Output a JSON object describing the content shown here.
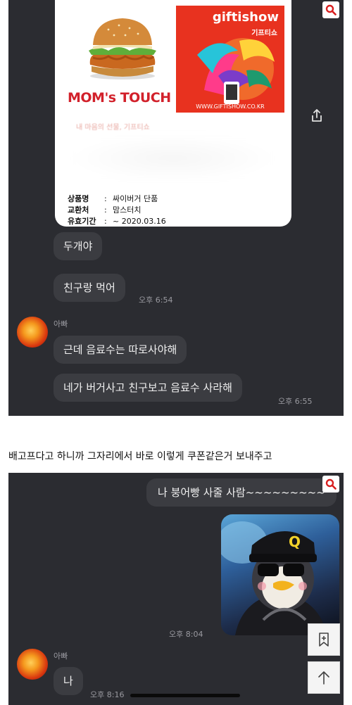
{
  "chat1": {
    "coupon": {
      "brand_logo": "MOM's TOUCH",
      "giftshow_title": "giftishow",
      "giftshow_sub": "기프티쇼",
      "giftshow_url": "WWW.GIFTISHOW.CO.KR",
      "blurred_message": "내 마음의 선물, 기프티쇼",
      "fields": [
        {
          "label": "상품명",
          "value": "싸이버거 단품"
        },
        {
          "label": "교환처",
          "value": "맘스터치"
        },
        {
          "label": "유효기간",
          "value": "~ 2020.03.16"
        }
      ]
    },
    "messages_sent": [
      {
        "text": "두개야"
      },
      {
        "text": "친구랑 먹어",
        "time": "오후 6:54"
      }
    ],
    "sender_name": "아빠",
    "messages_received": [
      {
        "text": "근데 음료수는 따로사야해"
      },
      {
        "text": "네가 버거사고 친구보고 음료수 사라해",
        "time": "오후 6:55"
      }
    ]
  },
  "caption": "배고프다고 하니까 그자리에서 바로 이렇게 쿠폰같은거 보내주고",
  "chat2": {
    "my_message": "나 붕어빵 사줄 사람~~~~~~~~~",
    "photo_time": "오후 8:04",
    "sender_name": "아빠",
    "reply": "나",
    "reply_time": "오후 8:16"
  },
  "colors": {
    "chat_bg": "#2b2c31",
    "bubble_bg": "#3b3c41",
    "search_icon": "#d81e1e",
    "brand_red": "#d2212b",
    "giftshow_orange": "#e8321f"
  }
}
